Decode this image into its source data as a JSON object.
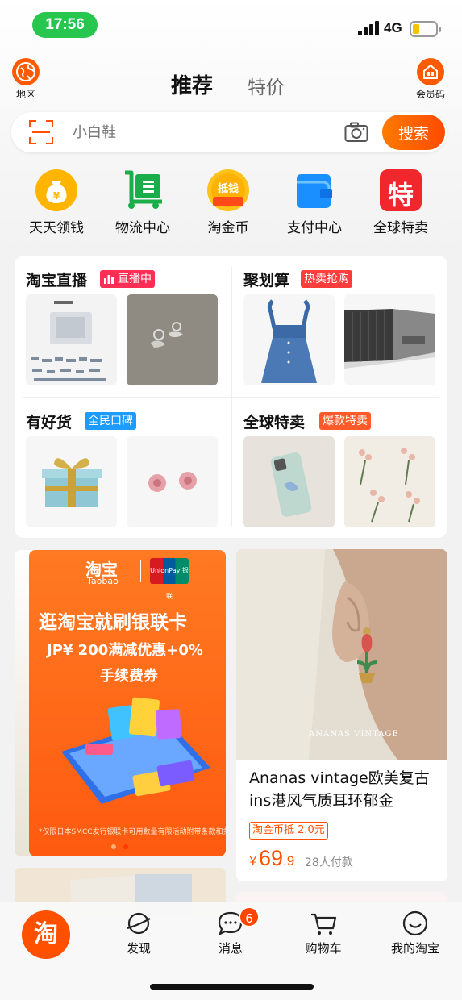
{
  "status": {
    "time": "17:56",
    "network": "4G"
  },
  "header": {
    "region_label": "地区",
    "member_label": "会员码",
    "tabs": [
      "推荐",
      "特价"
    ]
  },
  "search": {
    "placeholder": "小白鞋",
    "button": "搜索"
  },
  "quick_links": [
    {
      "label": "天天领钱",
      "icon": "money-bag-icon"
    },
    {
      "label": "物流中心",
      "icon": "logistics-cart-icon"
    },
    {
      "label": "淘金币",
      "icon": "gold-coin-icon",
      "icon_text": "抵钱"
    },
    {
      "label": "支付中心",
      "icon": "wallet-icon"
    },
    {
      "label": "全球特卖",
      "icon": "te-sale-icon",
      "icon_text": "特"
    }
  ],
  "channels": [
    {
      "title": "淘宝直播",
      "tag": "直播中",
      "tag_color": "#ff2e55"
    },
    {
      "title": "聚划算",
      "tag": "热卖抢购",
      "tag_color": "#ff3d3d"
    },
    {
      "title": "有好货",
      "tag": "全民口碑",
      "tag_color": "#1e9bff"
    },
    {
      "title": "全球特卖",
      "tag": "爆款特卖",
      "tag_color": "#ff5a2a"
    }
  ],
  "banner": {
    "logo_cn": "淘宝",
    "logo_en": "Taobao",
    "unionpay": "UnionPay 银联",
    "headline": "逛淘宝就刷银联卡",
    "offer_line1": "JP¥ 200满减优惠+0%",
    "offer_line2": "手续费券",
    "fine_print": "*仅限日本SMCC发行银联卡可用数量有限活动附带条款和条件"
  },
  "product": {
    "brand_watermark": "ANANAS VINTAGE",
    "title": "Ananas vintage欧美复古ins港风气质耳环郁金",
    "coupon": "淘金币抵 2.0元",
    "currency": "¥",
    "price_int": "69",
    "price_dec": ".9",
    "paid_count": "28人付款"
  },
  "tabbar": {
    "home_glyph": "淘",
    "items": [
      "发现",
      "消息",
      "购物车",
      "我的淘宝"
    ],
    "message_badge": "6"
  },
  "colors": {
    "brand": "#ff5000",
    "status_green": "#27c64f"
  }
}
